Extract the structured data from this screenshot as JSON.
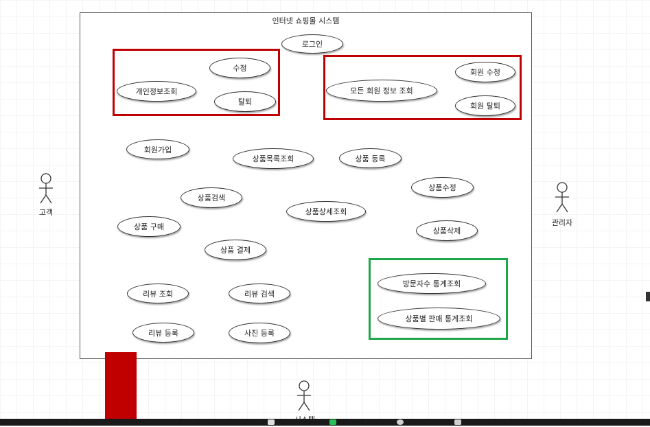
{
  "system": {
    "title": "인터넷 쇼핑몰 시스템"
  },
  "actors": {
    "customer": "고객",
    "admin": "관리자",
    "system": "시스템"
  },
  "use_cases": {
    "login": "로그인",
    "edit": "수정",
    "profile_view": "개인정보조회",
    "withdraw": "탈퇴",
    "all_member_view": "모든 회원 정보 조회",
    "member_edit": "회원 수정",
    "member_withdraw": "회원 탈퇴",
    "signup": "회원가입",
    "product_list": "상품목록조회",
    "product_register": "상품 등록",
    "product_edit": "상품수정",
    "product_search": "상품검색",
    "product_detail": "상품상세조회",
    "product_purchase": "상품 구매",
    "product_delete": "상품삭제",
    "product_payment": "상품 결제",
    "visitor_stats": "방문자수 통계조회",
    "sales_stats": "상품별 판매 통계조회",
    "review_view": "리뷰 조회",
    "review_search": "리뷰 검색",
    "review_register": "리뷰 등록",
    "photo_register": "사진 등록"
  },
  "colors": {
    "highlight_red": "#c00000",
    "highlight_green": "#1ea64a",
    "taskbar": "#1a1a1a"
  }
}
